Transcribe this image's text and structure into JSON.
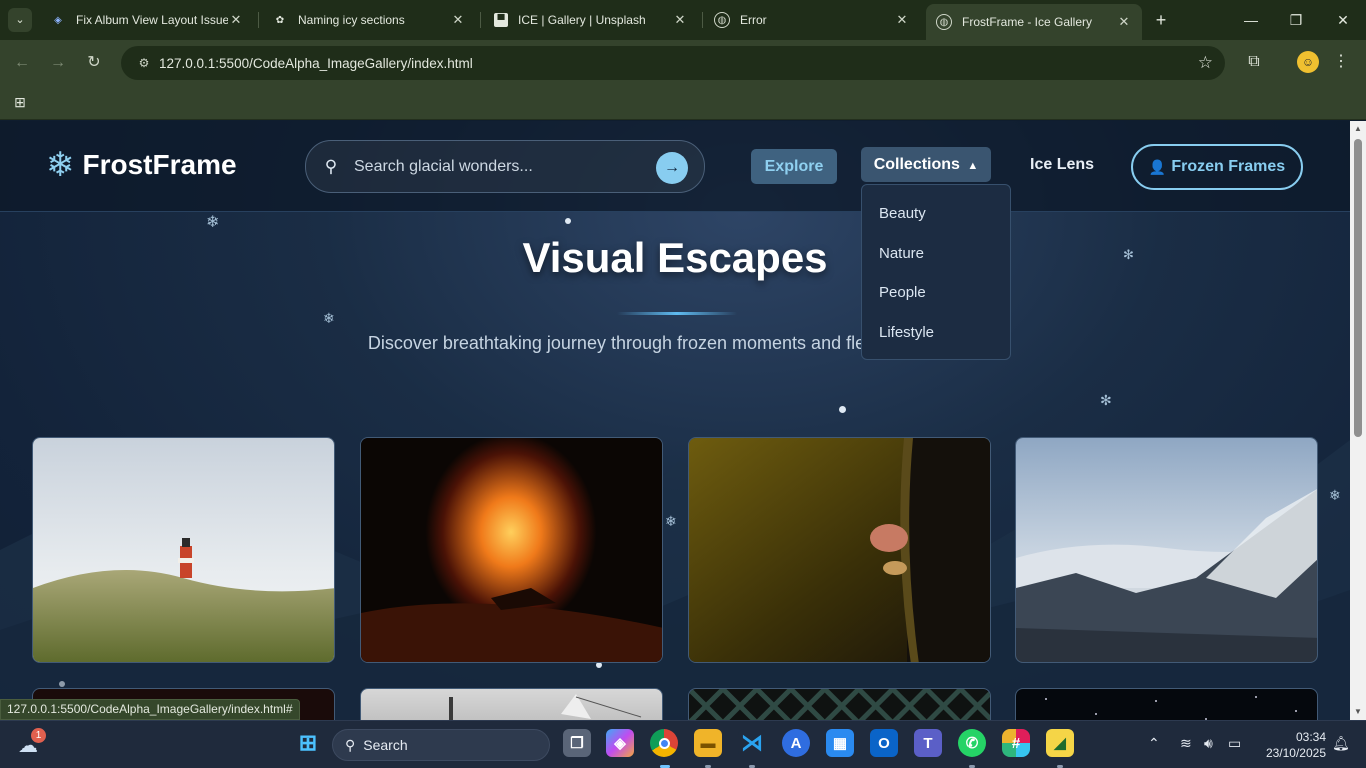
{
  "browser": {
    "tabs": [
      {
        "title": "Fix Album View Layout Issue",
        "icon": "copilot-icon"
      },
      {
        "title": "Naming icy sections",
        "icon": "chatgpt-icon"
      },
      {
        "title": "ICE | Gallery | Unsplash",
        "icon": "unsplash-icon"
      },
      {
        "title": "Error",
        "icon": "globe-icon"
      },
      {
        "title": "FrostFrame - Ice Gallery",
        "icon": "globe-icon"
      }
    ],
    "address": "127.0.0.1:5500/CodeAlpha_ImageGallery/index.html",
    "status_url": "127.0.0.1:5500/CodeAlpha_ImageGallery/index.html#"
  },
  "site": {
    "brand": "FrostFrame",
    "search": {
      "placeholder": "Search glacial wonders..."
    },
    "nav": {
      "explore": "Explore",
      "collections": "Collections",
      "lens": "Ice Lens",
      "frozen": "Frozen Frames"
    },
    "collections_menu": [
      "Beauty",
      "Nature",
      "People",
      "Lifestyle"
    ],
    "hero": {
      "title": "Visual Escapes",
      "subtitle": "Discover breathtaking journey through frozen moments and fleeting emotions"
    },
    "gallery": [
      {
        "subject": "lighthouse in grass field"
      },
      {
        "subject": "volcanic lava fountain"
      },
      {
        "subject": "mushrooms on tree trunk"
      },
      {
        "subject": "snowy mountain ridge above clouds"
      },
      {
        "subject": "dark image"
      },
      {
        "subject": "black and white boat"
      },
      {
        "subject": "lattice pattern"
      },
      {
        "subject": "starry night sky"
      }
    ]
  },
  "taskbar": {
    "search_label": "Search",
    "notification_count": "1",
    "time": "03:34",
    "date": "23/10/2025"
  }
}
